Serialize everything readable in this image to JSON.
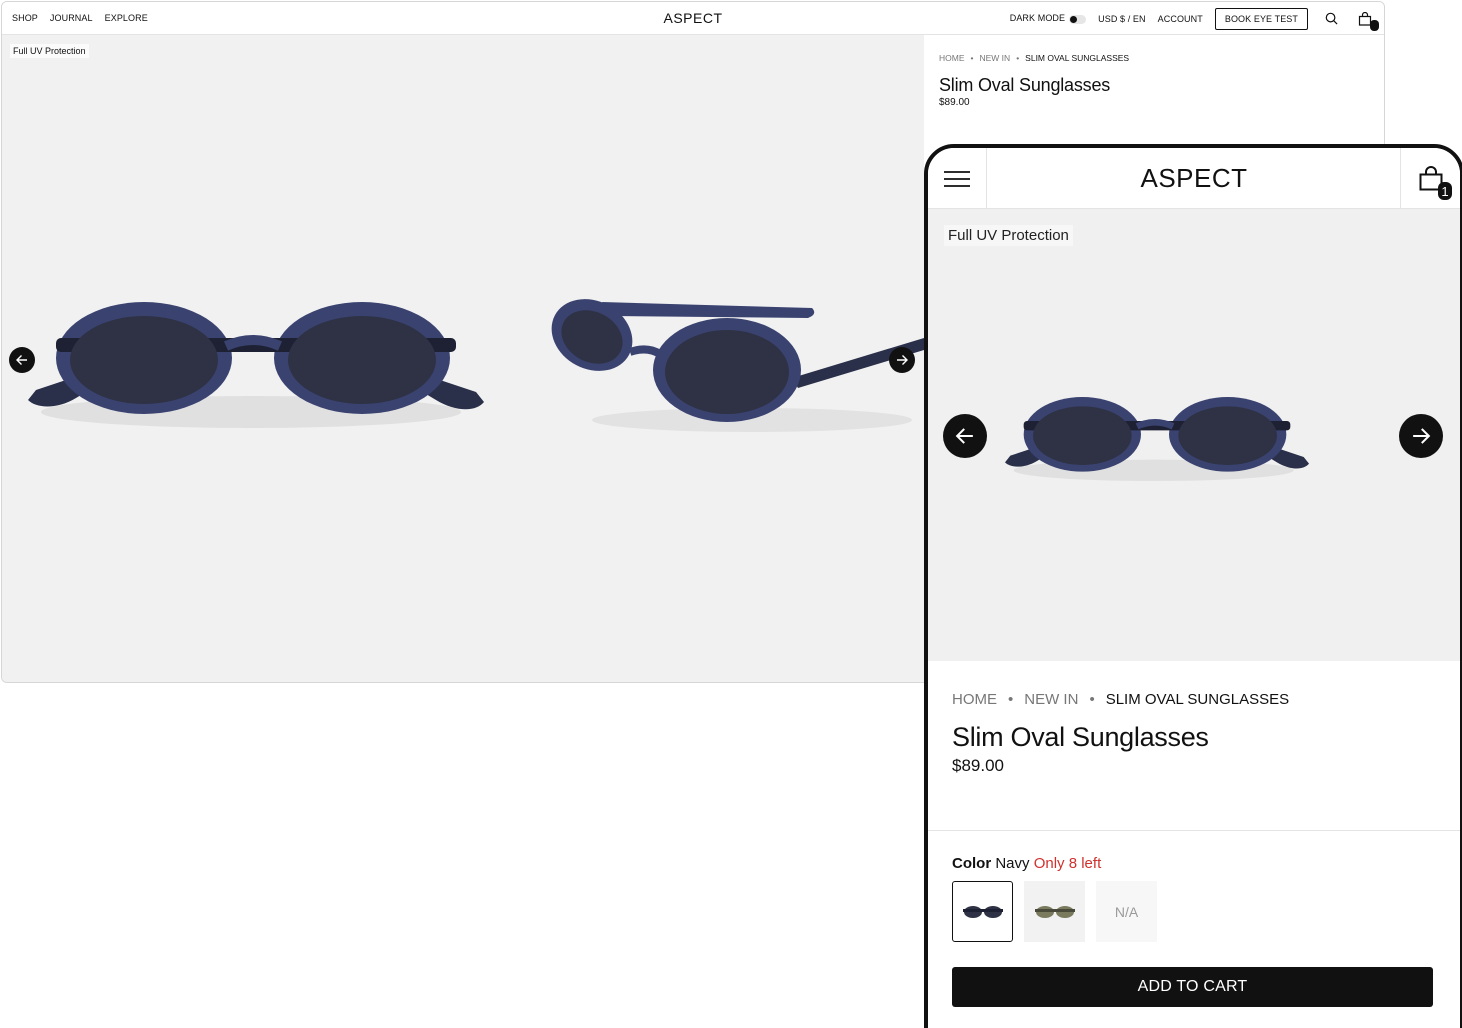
{
  "brand": "ASPECT",
  "desktop": {
    "nav": [
      "SHOP",
      "JOURNAL",
      "EXPLORE"
    ],
    "dark_mode_label": "DARK MODE",
    "currency_label": "USD $ / EN",
    "account_label": "ACCOUNT",
    "book_label": "BOOK EYE TEST",
    "cart_count": "1"
  },
  "badge": "Full UV Protection",
  "breadcrumb": {
    "home": "HOME",
    "section": "NEW IN",
    "current": "SLIM OVAL SUNGLASSES"
  },
  "product": {
    "title": "Slim Oval Sunglasses",
    "price": "$89.00",
    "color_label": "Color",
    "color_value": "Navy",
    "stock_note": "Only 8 left",
    "swatch_na": "N/A",
    "add_to_cart": "ADD TO CART"
  },
  "mobile": {
    "cart_count": "1"
  },
  "colors": {
    "frame": "#3a4270",
    "lens": "#2e3244",
    "stock_alert": "#d0312d"
  }
}
